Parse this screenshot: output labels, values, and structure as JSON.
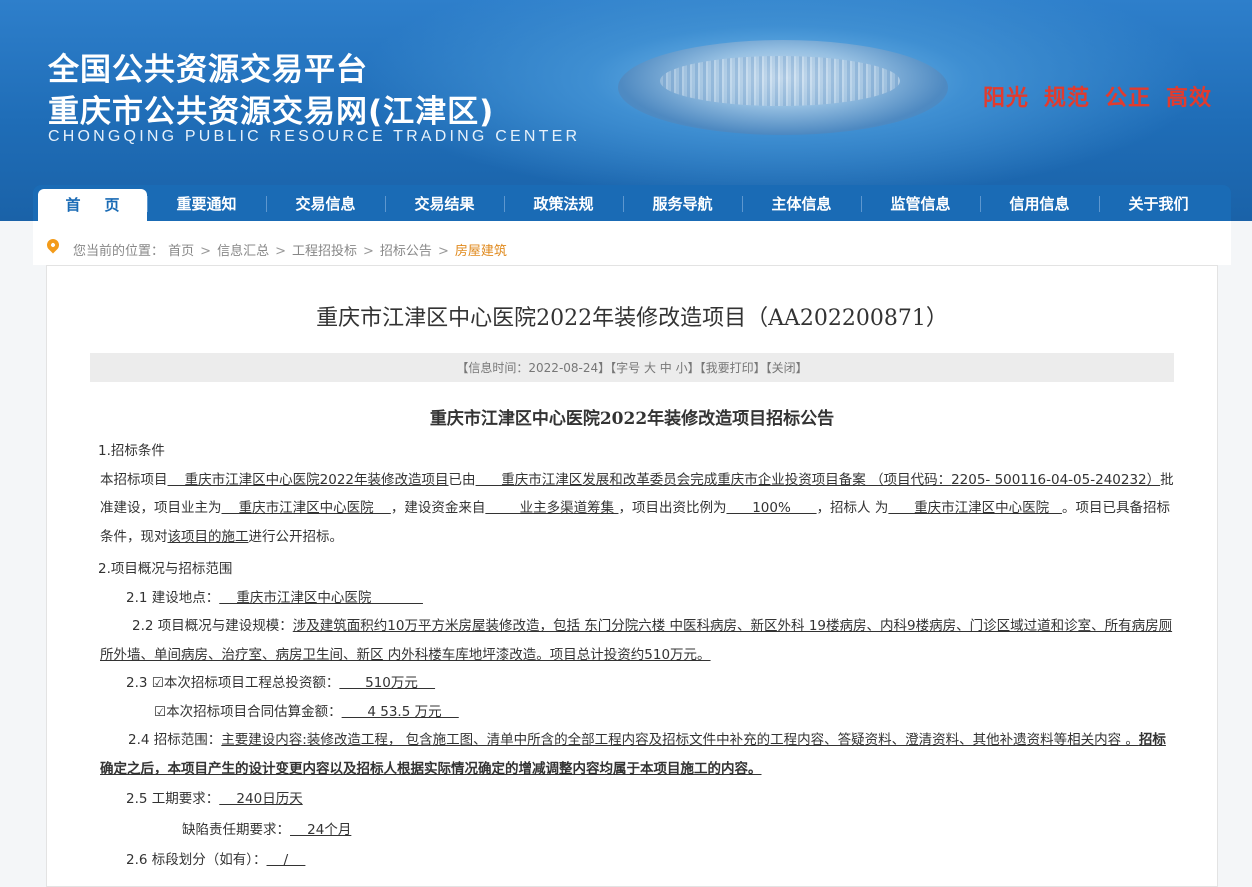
{
  "header": {
    "title_line1": "全国公共资源交易平台",
    "title_line2": "重庆市公共资源交易网(江津区)",
    "title_en": "CHONGQING PUBLIC RESOURCE TRADING CENTER",
    "slogans": [
      "阳光",
      "规范",
      "公正",
      "高效"
    ],
    "slogan_color": "#e23b2e"
  },
  "nav": {
    "items": [
      "首页",
      "重要通知",
      "交易信息",
      "交易结果",
      "政策法规",
      "服务导航",
      "主体信息",
      "监管信息",
      "信用信息",
      "关于我们"
    ],
    "active": "首页"
  },
  "breadcrumb": {
    "prefix": "您当前的位置：",
    "items": [
      "首页",
      "信息汇总",
      "工程招投标",
      "招标公告",
      "房屋建筑"
    ]
  },
  "article": {
    "title": "重庆市江津区中心医院2022年装修改造项目（AA202200871）",
    "info": "【信息时间：2022-08-24】【字号 大 中 小】【我要打印】【关闭】",
    "notice_title": "重庆市江津区中心医院2022年装修改造项目招标公告",
    "s1_heading": "1.招标条件",
    "s1_t1": "本招标项目",
    "s1_v1": "    重庆市江津区中心医院2022年装修改造项目",
    "s1_t2": "已由",
    "s1_v2": "      重庆市江津区发展和改革委员会",
    "s1_t3": "完成重庆市企业投资项目备案 （项目代码：",
    "s1_v3": "2205- 500116-04-05-240232）",
    "s1_t4": "批准建设，项目业主为",
    "s1_v4": "    重庆市江津区中心医院    ",
    "s1_t5": "，建设资金来自",
    "s1_v5": "        业主多渠道筹集 ",
    "s1_t6": "，项目出资比例为",
    "s1_v6": "      100%      ",
    "s1_t7": "，招标人 为",
    "s1_v7": "      重庆市江津区中心医院   ",
    "s1_t8": "。项目已具备招标条件，现对",
    "s1_v8": "该项目的施工",
    "s1_t9": "进行公开招标。",
    "s2_heading": "2.项目概况与招标范围",
    "s21_label": "2.1 建设地点：",
    "s21_value": "    重庆市江津区中心医院            ",
    "s22_label": "2.2 项目概况与建设规模：",
    "s22_value": "涉及建筑面积约10万平方米房屋装修改造，包括 东门分院六楼 中医科病房、新区外科 19楼病房、内科9楼病房、门诊区域过道和诊室、所有病房厕所外墙、单间病房、治疗室、病房卫生间、新区 内外科楼车库地坪漆改造。项目总计投资约510万元。",
    "s23_label": "2.3 ☑本次招标项目工程总投资额：",
    "s23_value": "      510万元    ",
    "s23b_label": "☑本次招标项目合同估算金额：",
    "s23b_value": "      4 53.5 万元    ",
    "s24_label": "2.4 招标范围：",
    "s24_value": "主要建设内容:装修改造工程， 包含施工图、清单中所含的全部工程内容及招标文件中补充的工程内容、答疑资料、澄清资料、其他补遗资料等相关内容 。",
    "s24_bold": "招标确定之后，本项目产生的设计变更内容以及招标人根据实际情况确定的增减调整内容均属于本项目施工的内容。",
    "s25_label": "2.5 工期要求：",
    "s25_value": "    240日历天",
    "s25b_label": "缺陷责任期要求：",
    "s25b_value": "    24个月",
    "s26_label": "2.6 标段划分（如有）：",
    "s26_value": "    /    "
  }
}
